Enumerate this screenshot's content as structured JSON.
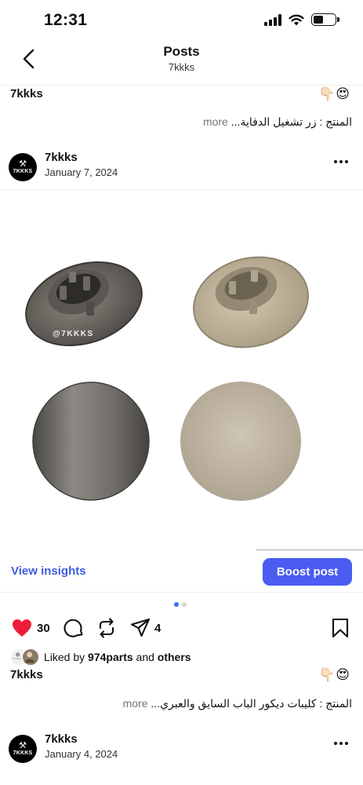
{
  "status_bar": {
    "time": "12:31"
  },
  "header": {
    "title": "Posts",
    "subtitle": "7kkks"
  },
  "prev_post": {
    "username": "7kkks",
    "emojis": "👇🏻😍",
    "caption": "المنتج : زر تشغيل الدفاية...",
    "more": "more"
  },
  "post": {
    "avatar_text": "7KKKS",
    "author": "7kkks",
    "date": "January 7, 2024",
    "image_watermark": "@7KKKS",
    "insights_label": "View insights",
    "boost_label": "Boost post",
    "likes_count": "30",
    "shares_count": "4",
    "liked_by_prefix": "Liked by",
    "liked_by_user": "974parts",
    "liked_by_and": "and",
    "liked_by_others": "others",
    "username": "7kkks",
    "emojis": "👇🏻😍",
    "caption": "المنتج : كليبات ديكور الباب السايق والعبري...",
    "more": "more",
    "liked_avatar_label": "974parts"
  },
  "next_post": {
    "avatar_text": "7KKKS",
    "author": "7kkks",
    "date": "January 4, 2024"
  },
  "colors": {
    "accent": "#4a5cf2",
    "link": "#3d5ce0",
    "like": "#ed1c3c",
    "dot_active": "#3d6ef0",
    "dot_inactive": "#d4d4d4"
  },
  "icons": {
    "back": "chevron-left-icon",
    "options": "more-horizontal-icon",
    "like": "heart-icon",
    "comment": "comment-icon",
    "repost": "repost-icon",
    "share": "send-icon",
    "save": "bookmark-icon"
  }
}
